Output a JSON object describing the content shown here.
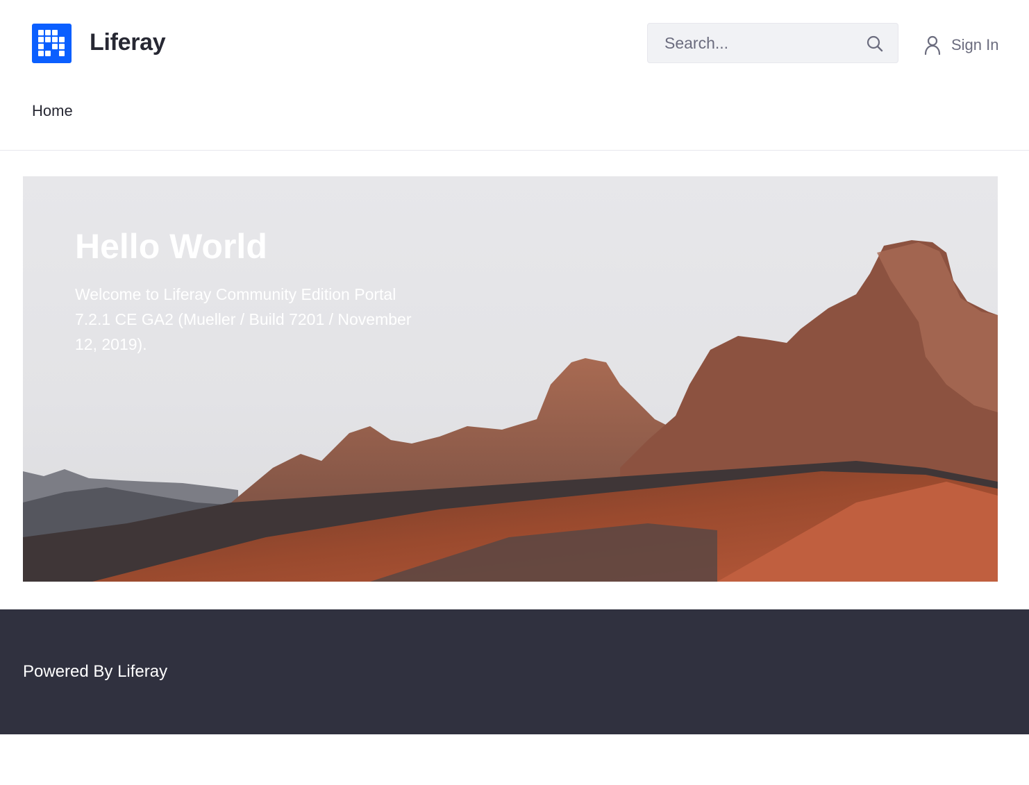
{
  "header": {
    "site_name": "Liferay",
    "search": {
      "placeholder": "Search..."
    },
    "signin_label": "Sign In"
  },
  "nav": {
    "items": [
      {
        "label": "Home"
      }
    ]
  },
  "hero": {
    "title": "Hello World",
    "text": "Welcome to Liferay Community Edition Portal 7.2.1 CE GA2 (Mueller / Build 7201 / November 12, 2019)."
  },
  "footer": {
    "text": "Powered By Liferay"
  },
  "colors": {
    "brand": "#0b5fff",
    "footer_bg": "#30313f",
    "text": "#272833",
    "muted": "#6b6c7e"
  }
}
